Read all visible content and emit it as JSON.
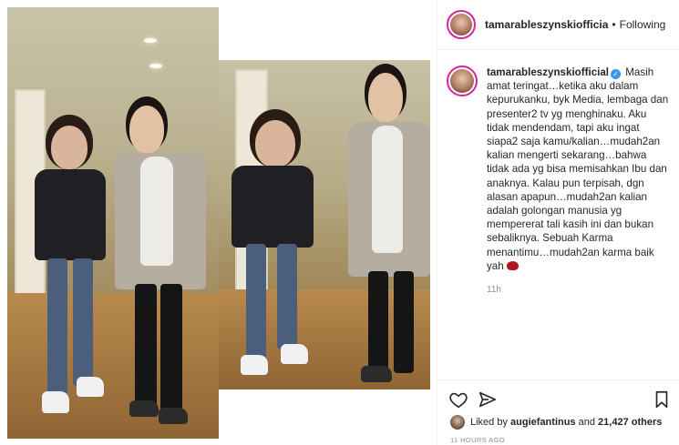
{
  "post": {
    "username": "tamarableszynskiofficial",
    "header_username": "tamarableszynskiofficia",
    "follow_separator": "•",
    "follow_status": "Following",
    "verified_mark": "✓",
    "caption": "Masih amat teringat…ketika aku dalam kepurukanku, byk Media, lembaga dan presenter2 tv yg menghinaku. Aku tidak mendendam, tapi aku ingat siapa2 saja kamu/kalian…mudah2an kalian mengerti sekarang…bahwa tidak ada yg bisa memisahkan Ibu dan anaknya. Kalau pun terpisah, dgn alasan apapun…mudah2an kalian adalah golongan manusia yg mempererat tali kasih ini dan bukan sebaliknya. Sebuah Karma menantimu…mudah2an karma baik yah",
    "caption_time": "11h",
    "likes_prefix": "Liked by",
    "likes_user": "augiefantinus",
    "likes_and": "and",
    "likes_count": "21,427 others",
    "timestamp": "11 HOURS AGO"
  },
  "icons": {
    "heart": "heart-icon",
    "comment": "comment-icon",
    "share": "share-icon",
    "save": "bookmark-icon",
    "caption_emoji": "red-heart-emoji"
  },
  "colors": {
    "verified": "#3897f0",
    "story_ring": "#d6249f",
    "secondary_text": "#8e8e8e",
    "border": "#efefef"
  }
}
